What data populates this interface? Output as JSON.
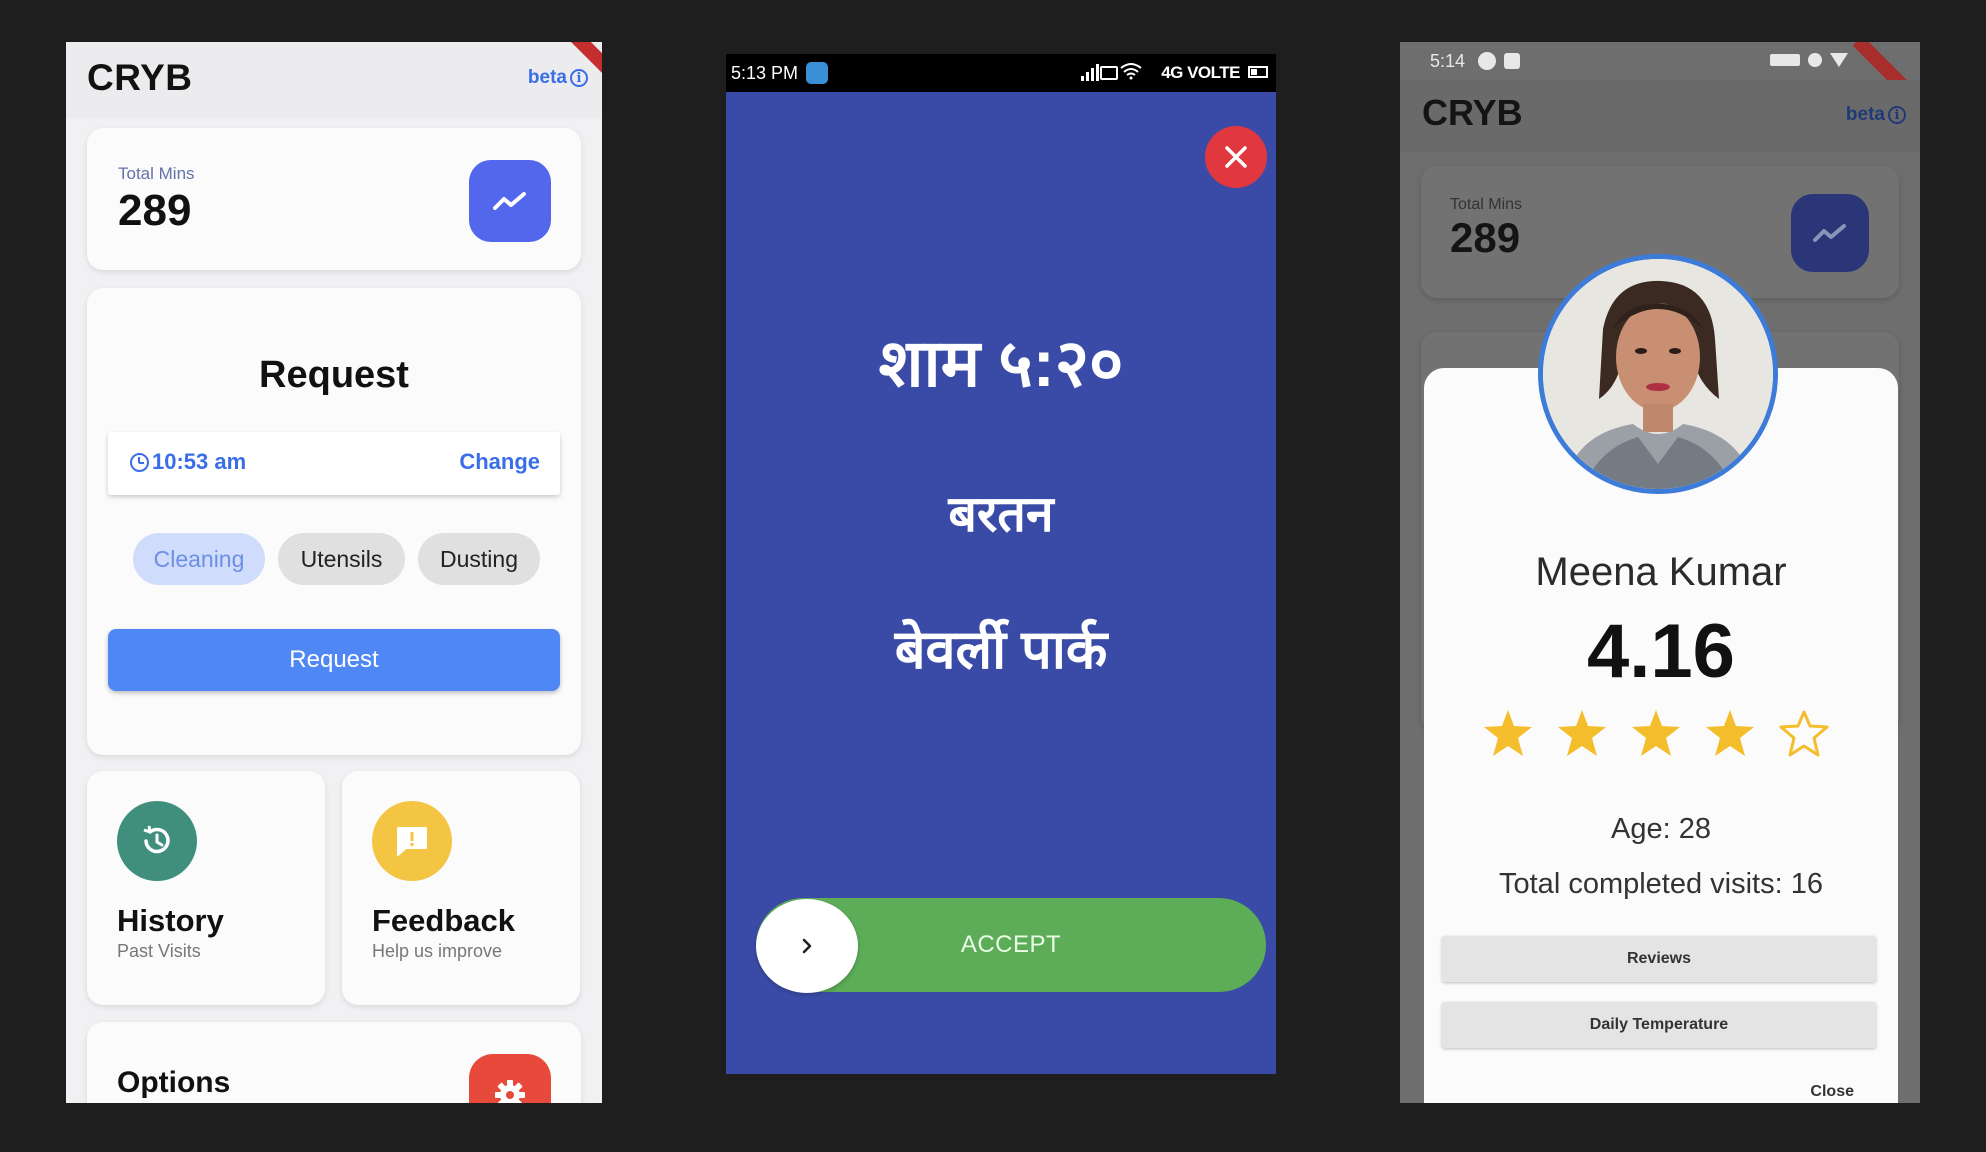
{
  "screen1": {
    "app_title": "CRYB",
    "beta_label": "beta",
    "total_mins": {
      "label": "Total Mins",
      "value": "289"
    },
    "request_card": {
      "title": "Request",
      "time": "10:53 am",
      "change_label": "Change",
      "chips": [
        {
          "label": "Cleaning",
          "selected": true
        },
        {
          "label": "Utensils",
          "selected": false
        },
        {
          "label": "Dusting",
          "selected": false
        }
      ],
      "button_label": "Request"
    },
    "history": {
      "title": "History",
      "subtitle": "Past Visits"
    },
    "feedback": {
      "title": "Feedback",
      "subtitle": "Help us improve"
    },
    "options": {
      "title": "Options"
    },
    "colors": {
      "accent": "#4f87f5",
      "trend_button": "#5267ec",
      "history_icon": "#3f8f7c",
      "feedback_icon": "#f4c542",
      "options_icon": "#e74a3b"
    }
  },
  "screen2": {
    "status_time": "5:13 PM",
    "network": "4G VOLTE",
    "time_text": "शाम ५:२०",
    "task_text": "बरतन",
    "place_text": "बेवर्ली पार्क",
    "accept_label": "ACCEPT",
    "colors": {
      "background": "#3a4ba7",
      "accept": "#5cac58",
      "close": "#e0383e"
    }
  },
  "screen3": {
    "status_time": "5:14",
    "app_title": "CRYB",
    "beta_label": "beta",
    "total_mins": {
      "label": "Total Mins",
      "value": "289"
    },
    "profile": {
      "name": "Meena Kumar",
      "rating": "4.16",
      "stars_filled": 4,
      "stars_total": 5,
      "age": "Age: 28",
      "visits": "Total completed visits: 16",
      "reviews_button": "Reviews",
      "temperature_button": "Daily Temperature",
      "close_label": "Close"
    }
  }
}
